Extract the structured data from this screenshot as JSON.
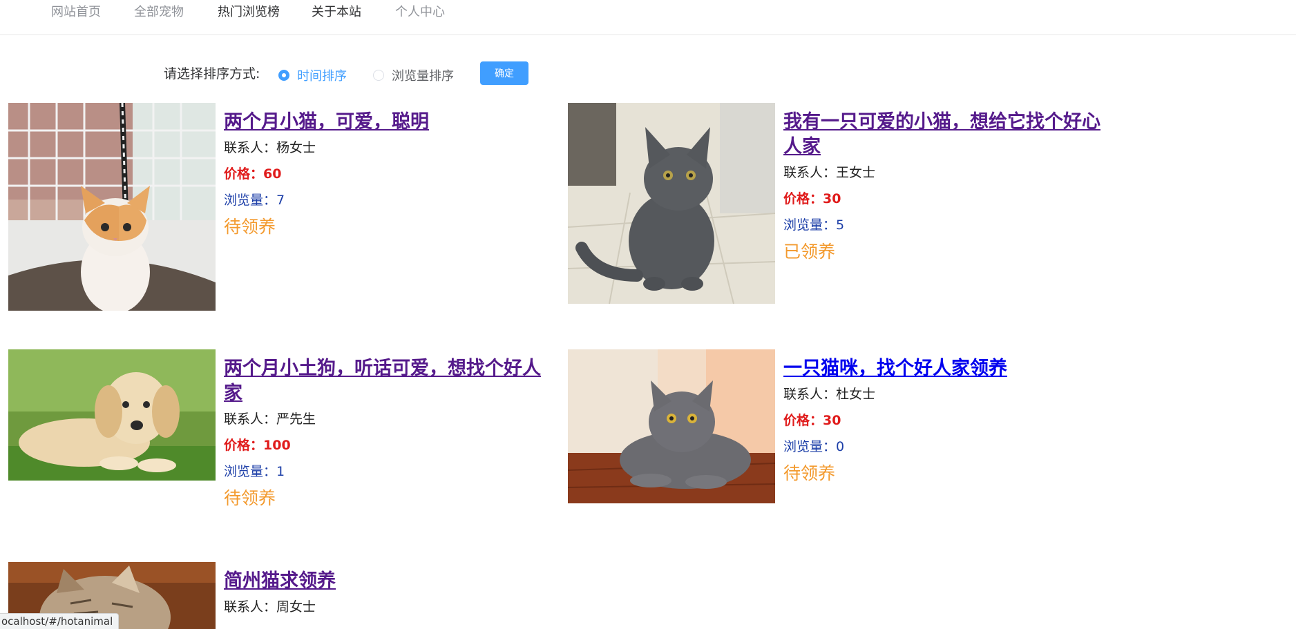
{
  "nav": {
    "items": [
      {
        "label": "网站首页"
      },
      {
        "label": "全部宠物"
      },
      {
        "label": "热门浏览榜"
      },
      {
        "label": "关于本站"
      },
      {
        "label": "个人中心"
      }
    ]
  },
  "sort": {
    "label": "请选择排序方式:",
    "options": [
      {
        "label": "时间排序",
        "checked": true
      },
      {
        "label": "浏览量排序",
        "checked": false
      }
    ],
    "confirm_label": "确定"
  },
  "pets": [
    {
      "title": "两个月小猫，可爱，聪明",
      "contact": "联系人：杨女士",
      "price": "价格：60",
      "views": "浏览量：7",
      "status": "待领养",
      "image": "kitten-orange-white"
    },
    {
      "title": "我有一只可爱的小猫，想给它找个好心人家",
      "contact": "联系人：王女士",
      "price": "价格：30",
      "views": "浏览量：5",
      "status": "已领养",
      "image": "grey-cat-sitting"
    },
    {
      "title": "两个月小土狗，听话可爱，想找个好人家",
      "contact": "联系人：严先生",
      "price": "价格：100",
      "views": "浏览量：1",
      "status": "待领养",
      "image": "golden-puppy-grass"
    },
    {
      "title": "一只猫咪，找个好人家领养",
      "contact": "联系人：杜女士",
      "price": "价格：30",
      "views": "浏览量：0",
      "status": "待领养",
      "image": "grey-cat-lying"
    },
    {
      "title": "简州猫求领养",
      "contact": "联系人：周女士",
      "image": "tabby-cat"
    }
  ],
  "statusbar": {
    "url": "ocalhost/#/hotanimal"
  },
  "colors": {
    "accent": "#409eff",
    "price": "#e01b1b",
    "views": "#1d3fa8",
    "status": "#f39a2e",
    "visited_link": "#551a8b",
    "link": "#0000ee"
  }
}
